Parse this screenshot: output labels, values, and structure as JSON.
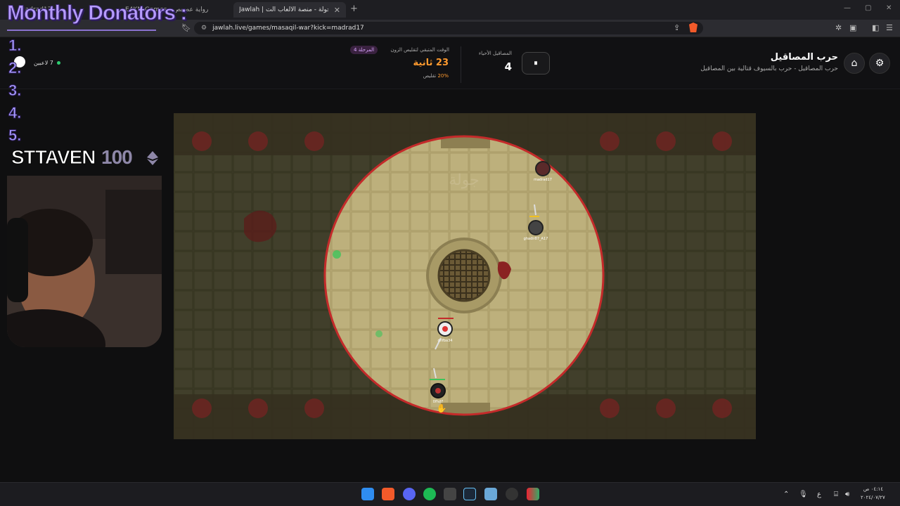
{
  "browser": {
    "tabs": [
      {
        "label": "Madrad17 - ...",
        "active": false
      },
      {
        "label": "E4KM Games - رواية عصعص",
        "active": false
      },
      {
        "label": "Jawlah | جولة - منصة الألعاب الت",
        "active": true
      }
    ],
    "new_tab": "+",
    "url": "jawlah.live/games/masaqil-war?kick=madrad17"
  },
  "header": {
    "title": "حرب المصاقيل",
    "subtitle": "حرب المصاقيل - حرب بالسيوف قتالية بين المصاقيل",
    "alive_label": "المصاقيل الأحياء",
    "alive_count": "4",
    "pause_icon": "⏸",
    "round_badge": "المرحلة 4",
    "timer_label": "الوقت المتبقي لتقليص الزون",
    "timer_value": "23 ثانية",
    "shrink_percent": "20%",
    "shrink_label": "تقليص",
    "players_count": "7 لاعبين"
  },
  "arena": {
    "watermark": "جولة",
    "players": [
      {
        "name": "madrad17"
      },
      {
        "name": "ghadir87_A17"
      },
      {
        "name": "drifba34"
      },
      {
        "name": "0fhd7"
      }
    ]
  },
  "overlay": {
    "title": "Monthly Donators :",
    "ranks": [
      "1.",
      "2.",
      "3.",
      "4.",
      "5."
    ],
    "sub_name": "STTAVEN",
    "sub_count": "100"
  },
  "tray": {
    "time": "٠٤:١٤ ص",
    "date": "٢٠٢٤/٠٧/٢٧",
    "lang": "ع"
  }
}
